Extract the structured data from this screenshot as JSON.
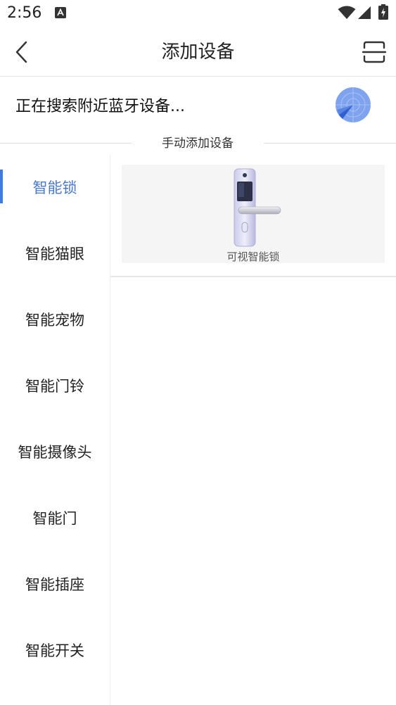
{
  "status_bar": {
    "time": "2:56",
    "icons": [
      "a-notification-icon",
      "wifi-icon",
      "signal-icon",
      "battery-icon"
    ]
  },
  "header": {
    "title": "添加设备",
    "back_icon": "chevron-left-icon",
    "scan_icon": "scan-icon"
  },
  "search": {
    "status_text": "正在搜索附近蓝牙设备...",
    "icon": "radar-icon",
    "accent_color": "#4a78e0"
  },
  "manual": {
    "label": "手动添加设备"
  },
  "categories": {
    "active_index": 0,
    "active_color": "#4a78c9",
    "items": [
      {
        "label": "智能锁"
      },
      {
        "label": "智能猫眼"
      },
      {
        "label": "智能宠物"
      },
      {
        "label": "智能门铃"
      },
      {
        "label": "智能摄像头"
      },
      {
        "label": "智能门"
      },
      {
        "label": "智能插座"
      },
      {
        "label": "智能开关"
      }
    ]
  },
  "devices": [
    {
      "label": "可视智能锁",
      "icon": "smart-lock-icon"
    }
  ]
}
